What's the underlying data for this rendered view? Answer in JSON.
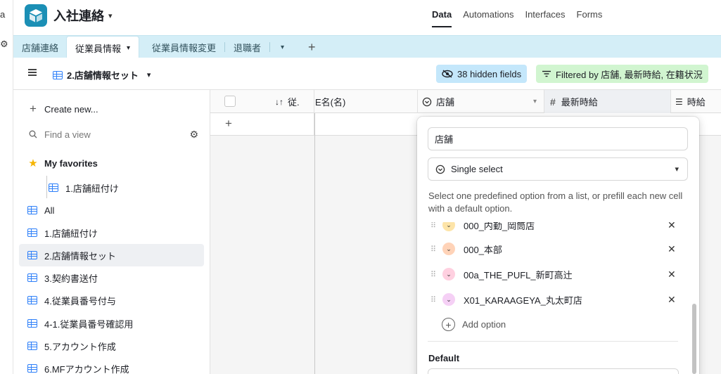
{
  "left_strip": {
    "glyph_top": "a",
    "glyph_mid": "⚙"
  },
  "header": {
    "base_title": "入社連絡",
    "nav": [
      {
        "label": "Data",
        "active": true
      },
      {
        "label": "Automations",
        "active": false
      },
      {
        "label": "Interfaces",
        "active": false
      },
      {
        "label": "Forms",
        "active": false
      }
    ]
  },
  "tabs": {
    "items": [
      "店舗連絡",
      "従業員情報",
      "従業員情報変更",
      "退職者"
    ],
    "active_index": 1,
    "more_icon": "chevron-down-icon",
    "add_icon": "plus-icon"
  },
  "viewbar": {
    "view_name": "2.店舗情報セット",
    "hidden_fields": "38 hidden fields",
    "filter": "Filtered by 店舗, 最新時給, 在籍状況"
  },
  "sidebar": {
    "create_new": "Create new...",
    "find_placeholder": "Find a view",
    "favorites_label": "My favorites",
    "favorite_items": [
      "1.店舗紐付け"
    ],
    "views": [
      "All",
      "1.店舗紐付け",
      "2.店舗情報セット",
      "3.契約書送付",
      "4.従業員番号付与",
      "4-1.従業員番号確認用",
      "5.アカウント作成",
      "6.MFアカウント作成"
    ],
    "selected_view": "2.店舗情報セット"
  },
  "grid": {
    "columns": [
      {
        "label": "従.",
        "icon": "sort-icon"
      },
      {
        "label": "E名(名)",
        "icon": ""
      },
      {
        "label": "店舗",
        "icon": "single-select-icon"
      },
      {
        "label": "最新時給",
        "icon": "number-icon"
      },
      {
        "label": "時給",
        "icon": "lookup-icon"
      }
    ],
    "add_row_icon": "plus-icon"
  },
  "popup": {
    "field_name": "店舗",
    "field_type": "Single select",
    "description": "Select one predefined option from a list, or prefill each new cell with a default option.",
    "options": [
      {
        "label": "000_内勤_岡筒店",
        "color": "#fde4a8"
      },
      {
        "label": "000_本部",
        "color": "#ffd3b8"
      },
      {
        "label": "00a_THE_PUFL_新町高辻",
        "color": "#ffd0e0"
      },
      {
        "label": "X01_KARAAGEYA_丸太町店",
        "color": "#f5d0f5"
      }
    ],
    "add_option": "Add option",
    "default_label": "Default"
  }
}
